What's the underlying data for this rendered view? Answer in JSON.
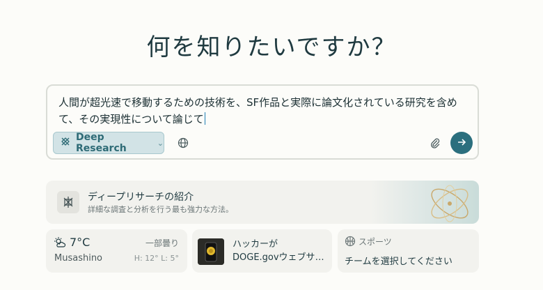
{
  "heading": "何を知りたいですか？",
  "query": {
    "text": "人間が超光速で移動するための技術を、SF作品と実際に論文化されている研究を含めて、その実現性について論じて"
  },
  "toolbar": {
    "mode_label": "Deep Research",
    "mode_icon": "deep-research-icon",
    "globe_icon": "globe-icon",
    "attach_icon": "paperclip-icon",
    "send_icon": "arrow-right-icon",
    "accent_color": "#2b6f7e"
  },
  "promo": {
    "title": "ディープリサーチの紹介",
    "subtitle": "詳細な調査と分析を行う最も強力な方法。"
  },
  "weather": {
    "temperature": "7°C",
    "condition": "一部曇り",
    "location": "Musashino",
    "high_low": "H: 12° L: 5°"
  },
  "news": {
    "title_line1": "ハッカーが",
    "title_line2": "DOGE.govウェブサイト…"
  },
  "sports": {
    "label": "スポーツ",
    "text": "チームを選択してください"
  }
}
